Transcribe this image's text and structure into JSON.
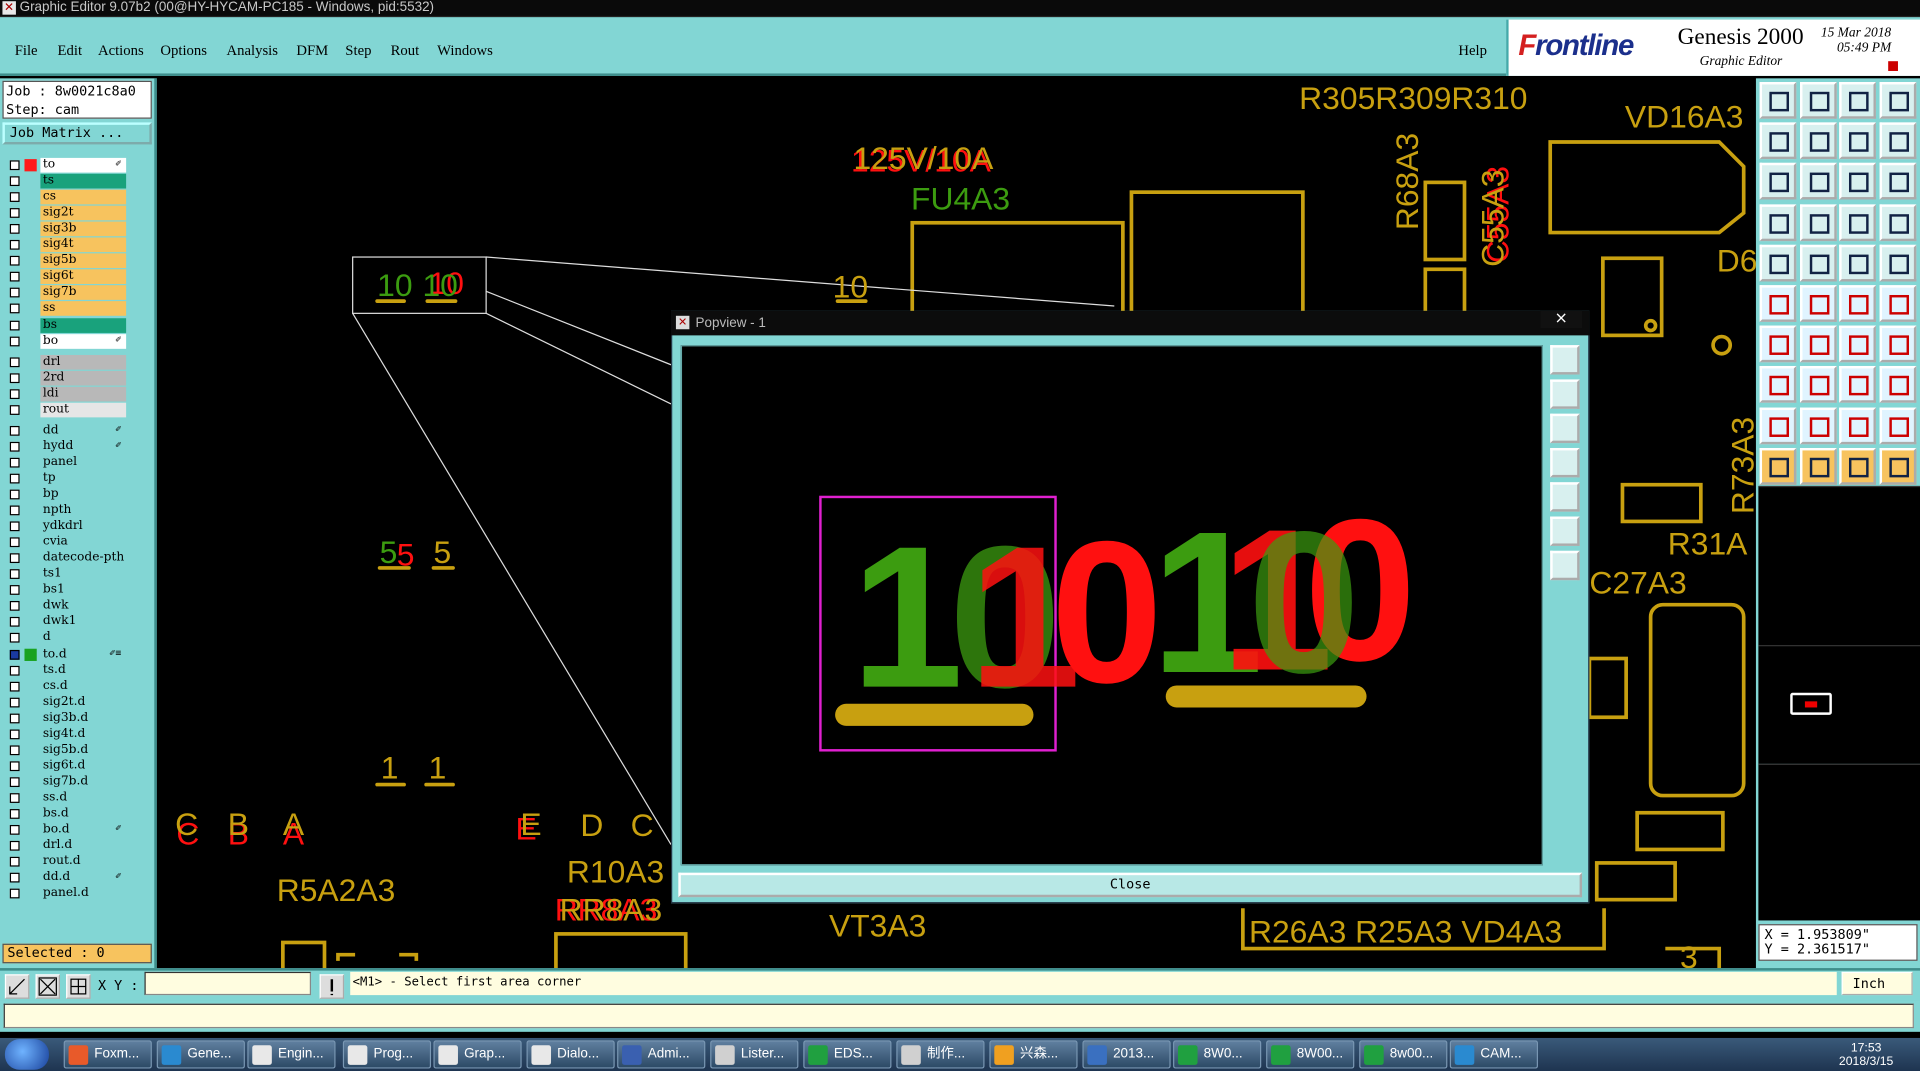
{
  "window": {
    "title": "Graphic Editor 9.07b2 (00@HY-HYCAM-PC185 - Windows, pid:5532)"
  },
  "menu": [
    "File",
    "Edit",
    "Actions",
    "Options",
    "Analysis",
    "DFM",
    "Step",
    "Rout",
    "Windows"
  ],
  "help": "Help",
  "brand": {
    "logo_pre": "F",
    "logo": "rontline",
    "product": "Genesis 2000",
    "subtitle": "Graphic Editor",
    "date": "15 Mar 2018",
    "time": "05:49 PM"
  },
  "job": {
    "job_line": "Job : 8w0021c8a0",
    "step_line": "Step: cam",
    "matrix_button": "Job Matrix ..."
  },
  "layers": [
    {
      "name": "to",
      "color": "#ffffff",
      "swatch": "#ff1a1a",
      "edit": "✐"
    },
    {
      "name": "ts",
      "color": "#19a27c",
      "swatch": "",
      "edit": ""
    },
    {
      "name": "cs",
      "color": "#f7c35e",
      "swatch": "",
      "edit": ""
    },
    {
      "name": "sig2t",
      "color": "#f7c35e",
      "swatch": "",
      "edit": ""
    },
    {
      "name": "sig3b",
      "color": "#f7c35e",
      "swatch": "",
      "edit": ""
    },
    {
      "name": "sig4t",
      "color": "#f7c35e",
      "swatch": "",
      "edit": ""
    },
    {
      "name": "sig5b",
      "color": "#f7c35e",
      "swatch": "",
      "edit": ""
    },
    {
      "name": "sig6t",
      "color": "#f7c35e",
      "swatch": "",
      "edit": ""
    },
    {
      "name": "sig7b",
      "color": "#f7c35e",
      "swatch": "",
      "edit": ""
    },
    {
      "name": "ss",
      "color": "#f7c35e",
      "swatch": "",
      "edit": ""
    },
    {
      "name": "bs",
      "color": "#19a27c",
      "swatch": "",
      "edit": ""
    },
    {
      "name": "bo",
      "color": "#ffffff",
      "swatch": "",
      "edit": "✐"
    },
    {
      "name": "drl",
      "color": "#b8b8b8",
      "swatch": "",
      "edit": ""
    },
    {
      "name": "2rd",
      "color": "#b8b8b8",
      "swatch": "",
      "edit": ""
    },
    {
      "name": "ldi",
      "color": "#b8b8b8",
      "swatch": "",
      "edit": ""
    },
    {
      "name": "rout",
      "color": "#e6e6e6",
      "swatch": "",
      "edit": ""
    },
    {
      "name": "dd",
      "color": "#82d6d4",
      "swatch": "",
      "edit": "✐"
    },
    {
      "name": "hydd",
      "color": "#82d6d4",
      "swatch": "",
      "edit": "✐"
    },
    {
      "name": "panel",
      "color": "#82d6d4",
      "swatch": "",
      "edit": ""
    },
    {
      "name": "tp",
      "color": "#82d6d4",
      "swatch": "",
      "edit": ""
    },
    {
      "name": "bp",
      "color": "#82d6d4",
      "swatch": "",
      "edit": ""
    },
    {
      "name": "npth",
      "color": "#82d6d4",
      "swatch": "",
      "edit": ""
    },
    {
      "name": "ydkdrl",
      "color": "#82d6d4",
      "swatch": "",
      "edit": ""
    },
    {
      "name": "cvia",
      "color": "#82d6d4",
      "swatch": "",
      "edit": ""
    },
    {
      "name": "datecode-pth",
      "color": "#82d6d4",
      "swatch": "",
      "edit": ""
    },
    {
      "name": "ts1",
      "color": "#82d6d4",
      "swatch": "",
      "edit": ""
    },
    {
      "name": "bs1",
      "color": "#82d6d4",
      "swatch": "",
      "edit": ""
    },
    {
      "name": "dwk",
      "color": "#82d6d4",
      "swatch": "",
      "edit": ""
    },
    {
      "name": "dwk1",
      "color": "#82d6d4",
      "swatch": "",
      "edit": ""
    },
    {
      "name": "d",
      "color": "#82d6d4",
      "swatch": "",
      "edit": ""
    },
    {
      "name": "to.d",
      "color": "#82d6d4",
      "swatch": "#19a220",
      "edit": "✐≡"
    },
    {
      "name": "ts.d",
      "color": "#82d6d4",
      "swatch": "",
      "edit": ""
    },
    {
      "name": "cs.d",
      "color": "#82d6d4",
      "swatch": "",
      "edit": ""
    },
    {
      "name": "sig2t.d",
      "color": "#82d6d4",
      "swatch": "",
      "edit": ""
    },
    {
      "name": "sig3b.d",
      "color": "#82d6d4",
      "swatch": "",
      "edit": ""
    },
    {
      "name": "sig4t.d",
      "color": "#82d6d4",
      "swatch": "",
      "edit": ""
    },
    {
      "name": "sig5b.d",
      "color": "#82d6d4",
      "swatch": "",
      "edit": ""
    },
    {
      "name": "sig6t.d",
      "color": "#82d6d4",
      "swatch": "",
      "edit": ""
    },
    {
      "name": "sig7b.d",
      "color": "#82d6d4",
      "swatch": "",
      "edit": ""
    },
    {
      "name": "ss.d",
      "color": "#82d6d4",
      "swatch": "",
      "edit": ""
    },
    {
      "name": "bs.d",
      "color": "#82d6d4",
      "swatch": "",
      "edit": ""
    },
    {
      "name": "bo.d",
      "color": "#82d6d4",
      "swatch": "",
      "edit": "✐"
    },
    {
      "name": "drl.d",
      "color": "#82d6d4",
      "swatch": "",
      "edit": ""
    },
    {
      "name": "rout.d",
      "color": "#82d6d4",
      "swatch": "",
      "edit": ""
    },
    {
      "name": "dd.d",
      "color": "#82d6d4",
      "swatch": "",
      "edit": "✐"
    },
    {
      "name": "panel.d",
      "color": "#82d6d4",
      "swatch": "",
      "edit": ""
    }
  ],
  "selected": "Selected : 0",
  "canvas_labels": {
    "fuse_rating": "125V/10A",
    "fuse_ref": "FU4A3",
    "r305": "R305R309R310",
    "vd16": "VD16A3",
    "r68": "R68A3",
    "c55": "C55A3",
    "d6": "D6",
    "r73": "R73A3",
    "r31": "R31A",
    "c27": "C27A3",
    "ten_left": "10",
    "ten_red": "10",
    "ten_mid": "10",
    "ten_plain": "10",
    "five_g": "5",
    "five_r": "5",
    "five_y": "5",
    "one_a": "1",
    "one_b": "1",
    "letters_c": "C",
    "letters_b": "B",
    "letters_a": "A",
    "letters_e": "E",
    "letters_d": "D",
    "letters_c2": "C",
    "r5": "R5A2A3",
    "r10": "R10A3",
    "rr8": "RR8A3",
    "vt3": "VT3A3",
    "r26": "R26A3 R25A3 VD4A3",
    "three": "3"
  },
  "popview": {
    "title": "Popview - 1",
    "close_x": "×",
    "close_button": "Close",
    "big_one_left": "1",
    "big_zero_left": "0",
    "big_one_red": "1",
    "big_zero_red1": "0",
    "big_one_mid": "1",
    "big_zero_mid": "0",
    "big_one_red2": "1",
    "big_zero_red2": "0"
  },
  "coords": {
    "x": "X = 1.953809\"",
    "y": "Y = 2.361517\""
  },
  "status": {
    "xy_label": "X Y :",
    "message": "<M1> - Select first area corner",
    "unit": "Inch"
  },
  "taskbar": {
    "items": [
      {
        "label": "Foxm...",
        "color": "#e85a2a"
      },
      {
        "label": "Gene...",
        "color": "#2a8ad0"
      },
      {
        "label": "Engin...",
        "color": "#e8e8e8"
      },
      {
        "label": "Prog...",
        "color": "#e8e8e8"
      },
      {
        "label": "Grap...",
        "color": "#e8e8e8"
      },
      {
        "label": "Dialo...",
        "color": "#e8e8e8"
      },
      {
        "label": "Admi...",
        "color": "#3a60b0"
      },
      {
        "label": "Lister...",
        "color": "#d0d0d0"
      },
      {
        "label": "EDS...",
        "color": "#20a040"
      },
      {
        "label": "制作...",
        "color": "#d0d0d0"
      },
      {
        "label": "兴森...",
        "color": "#f0a020"
      },
      {
        "label": "2013...",
        "color": "#3a70c0"
      },
      {
        "label": "8W0...",
        "color": "#20a040"
      },
      {
        "label": "8W00...",
        "color": "#20a040"
      },
      {
        "label": "8w00...",
        "color": "#20a040"
      },
      {
        "label": "CAM...",
        "color": "#2a8ad0"
      }
    ],
    "time": "17:53",
    "date": "2018/3/15"
  },
  "colors": {
    "green": "#3c9c10",
    "red": "#ff1010",
    "gold": "#c8a010",
    "magenta": "#e020d0",
    "teal": "#82d6d4"
  }
}
